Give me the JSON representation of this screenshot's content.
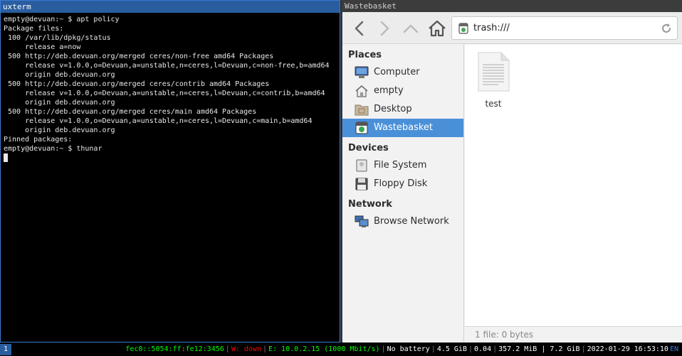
{
  "terminal": {
    "title": "uxterm",
    "lines": [
      "empty@devuan:~ $ apt policy",
      "Package files:",
      " 100 /var/lib/dpkg/status",
      "     release a=now",
      " 500 http://deb.devuan.org/merged ceres/non-free amd64 Packages",
      "     release v=1.0.0,o=Devuan,a=unstable,n=ceres,l=Devuan,c=non-free,b=amd64",
      "     origin deb.devuan.org",
      " 500 http://deb.devuan.org/merged ceres/contrib amd64 Packages",
      "     release v=1.0.0,o=Devuan,a=unstable,n=ceres,l=Devuan,c=contrib,b=amd64",
      "     origin deb.devuan.org",
      " 500 http://deb.devuan.org/merged ceres/main amd64 Packages",
      "     release v=1.0.0,o=Devuan,a=unstable,n=ceres,l=Devuan,c=main,b=amd64",
      "     origin deb.devuan.org",
      "Pinned packages:",
      "empty@devuan:~ $ thunar"
    ]
  },
  "filemanager": {
    "title": "Wastebasket",
    "location": "trash:///",
    "sidebar": {
      "places_header": "Places",
      "places": [
        {
          "label": "Computer",
          "icon": "computer-icon"
        },
        {
          "label": "empty",
          "icon": "home-icon"
        },
        {
          "label": "Desktop",
          "icon": "desktop-folder-icon"
        },
        {
          "label": "Wastebasket",
          "icon": "trash-icon"
        }
      ],
      "devices_header": "Devices",
      "devices": [
        {
          "label": "File System",
          "icon": "drive-icon"
        },
        {
          "label": "Floppy Disk",
          "icon": "floppy-icon"
        }
      ],
      "network_header": "Network",
      "network": [
        {
          "label": "Browse Network",
          "icon": "network-icon"
        }
      ]
    },
    "files": [
      {
        "name": "test",
        "icon": "text-document-icon"
      }
    ],
    "status": "1 file: 0 bytes",
    "accent": "#4a90d9"
  },
  "panel": {
    "workspace": "1",
    "ipv6": "fec0::5054:ff:fe12:3456",
    "wireless": "W: down",
    "ethernet": "E: 10.0.2.15 (1000 Mbit/s)",
    "battery": "No battery",
    "disk": "4.5 GiB",
    "load": "0.04",
    "memory": "357.2 MiB | 7.2 GiB",
    "datetime": "2022-01-29 16:53:10",
    "layout": "EN",
    "colors": {
      "good": "#00ff00",
      "bad": "#ff0000",
      "neutral": "#ffffff",
      "lang": "#3a7bd5"
    }
  }
}
